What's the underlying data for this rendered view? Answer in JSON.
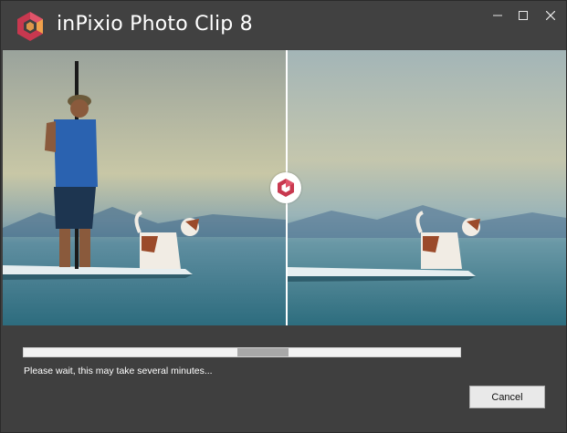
{
  "app": {
    "title": "inPixio Photo Clip 8",
    "brand_colors": {
      "primary": "#c8384f",
      "secondary": "#f0a04b"
    }
  },
  "window_controls": {
    "minimize_icon": "minimize-icon",
    "maximize_icon": "maximize-icon",
    "close_icon": "close-icon"
  },
  "preview": {
    "left_label": "",
    "right_label": "",
    "compare_handle_icon": "inpixio-logo-icon"
  },
  "progress": {
    "status_text": "Please wait, this may take several minutes...",
    "indeterminate": true
  },
  "actions": {
    "cancel_label": "Cancel"
  }
}
